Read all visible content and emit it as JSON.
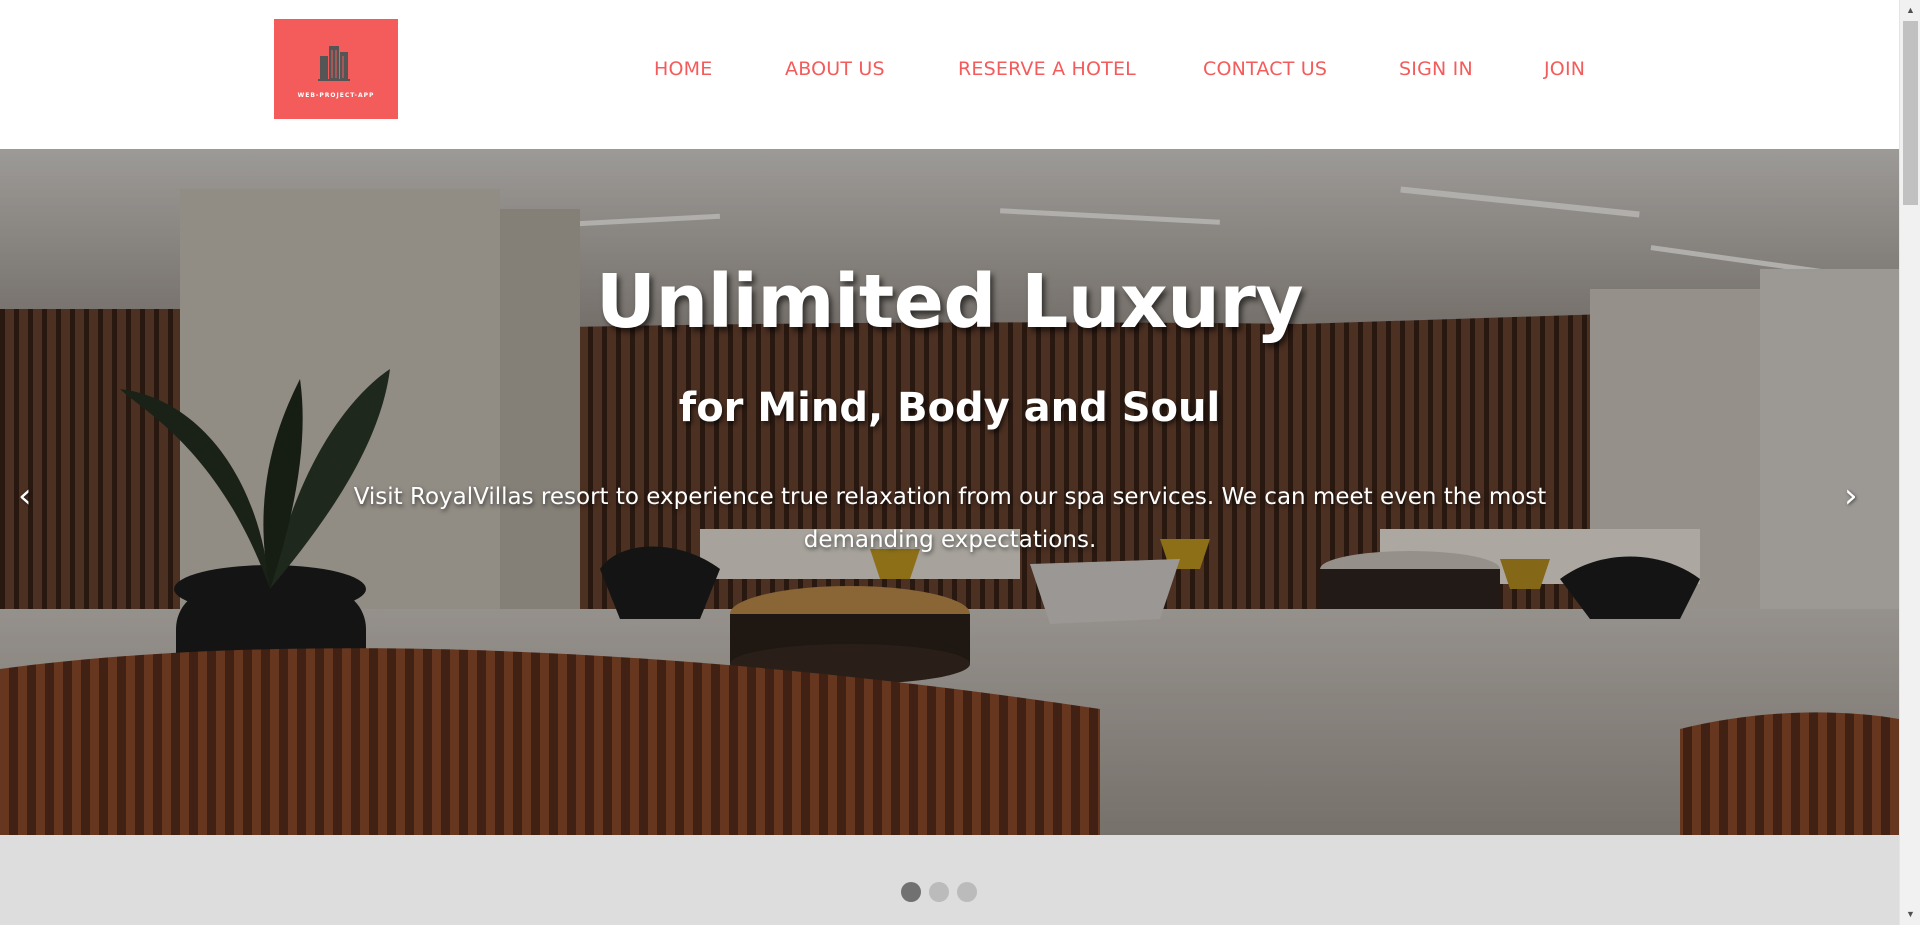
{
  "logo": {
    "text": "WEB-PROJECT-APP",
    "icon": "building-icon",
    "background": "#f45b5b"
  },
  "nav": {
    "color": "#f45b5b",
    "items": [
      {
        "label": "HOME"
      },
      {
        "label": "ABOUT US"
      },
      {
        "label": "RESERVE A HOTEL"
      },
      {
        "label": "CONTACT US"
      },
      {
        "label": "SIGN IN"
      },
      {
        "label": "JOIN"
      }
    ]
  },
  "hero": {
    "title": "Unlimited Luxury",
    "subtitle": "for Mind, Body and Soul",
    "text": "Visit RoyalVillas resort to experience true relaxation from our spa services. We can meet even the most demanding expectations.",
    "prev_arrow": "‹",
    "next_arrow": "›",
    "background_image": "hotel-lobby-photo"
  },
  "carousel": {
    "slide_count": 3,
    "active_index": 0,
    "active_dot_color": "#717171",
    "dot_color": "#bbbbbb"
  },
  "scrollbar": {
    "up_icon": "▲",
    "down_icon": "▼"
  }
}
